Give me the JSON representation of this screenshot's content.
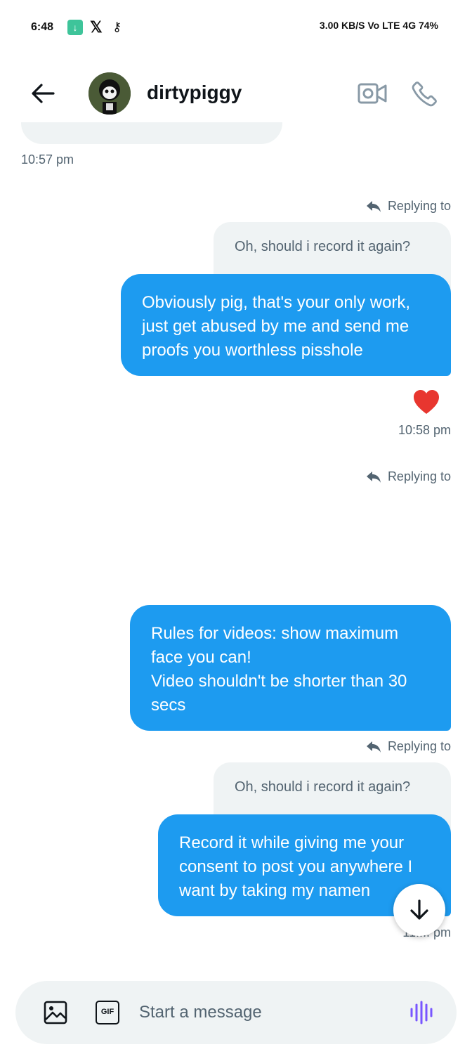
{
  "status_bar": {
    "time": "6:48",
    "right_text": "3.00 KB/S  Vo LTE  4G  74%"
  },
  "header": {
    "username": "dirtypiggy"
  },
  "messages": {
    "ts_1": "10:57 pm",
    "reply_1": "Replying to",
    "quote_1": "Oh, should i record it again?",
    "bubble_1": "Obviously pig, that's your only work, just get abused by me and send me proofs you worthless pisshole",
    "ts_2": "10:58 pm",
    "reply_2": "Replying to",
    "bubble_2_line1": "Rules for videos: show maximum face you can!",
    "bubble_2_line2": "Video shouldn't be shorter than 30 secs",
    "reply_3": "Replying to",
    "quote_3": "Oh, should i record it again?",
    "bubble_3": "Record it while giving me your consent to post you anywhere I want by taking my namen",
    "ts_3": "11:... pm"
  },
  "composer": {
    "placeholder": "Start a message"
  },
  "colors": {
    "accent": "#1d9bf0",
    "bubble_grey": "#eff3f4",
    "secondary_text": "#536471",
    "voice": "#7856ff"
  }
}
